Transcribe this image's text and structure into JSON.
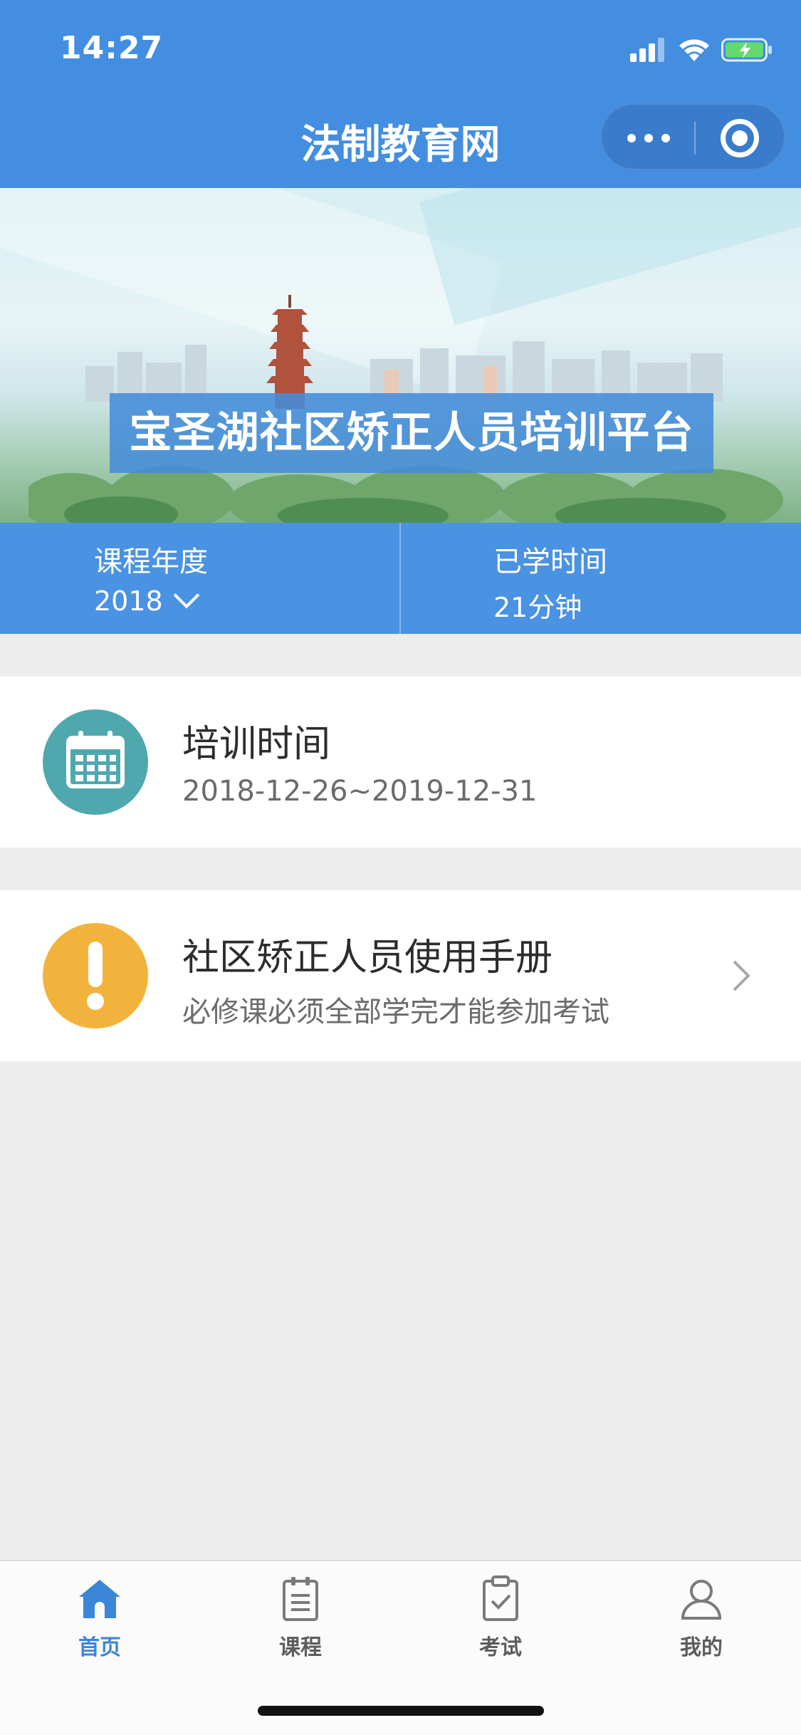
{
  "status_bar": {
    "time": "14:27"
  },
  "nav": {
    "title": "法制教育网"
  },
  "banner": {
    "title": "宝圣湖社区矫正人员培训平台"
  },
  "stats": {
    "year_label": "课程年度",
    "year_value": "2018",
    "time_label": "已学时间",
    "time_value": "21分钟"
  },
  "cards": [
    {
      "title": "培训时间",
      "subtitle": "2018-12-26~2019-12-31",
      "icon": "calendar-icon"
    },
    {
      "title": "社区矫正人员使用手册",
      "subtitle": "必修课必须全部学完才能参加考试",
      "icon": "exclamation-icon"
    }
  ],
  "tabbar": {
    "items": [
      {
        "label": "首页",
        "icon": "home-icon",
        "active": true
      },
      {
        "label": "课程",
        "icon": "document-icon",
        "active": false
      },
      {
        "label": "考试",
        "icon": "clipboard-check-icon",
        "active": false
      },
      {
        "label": "我的",
        "icon": "user-icon",
        "active": false
      }
    ]
  },
  "colors": {
    "header_blue": "#438ee0",
    "stats_blue": "#4a92e2",
    "teal": "#4fa8ae",
    "amber": "#f2b33c",
    "tab_active": "#3c86d8"
  }
}
